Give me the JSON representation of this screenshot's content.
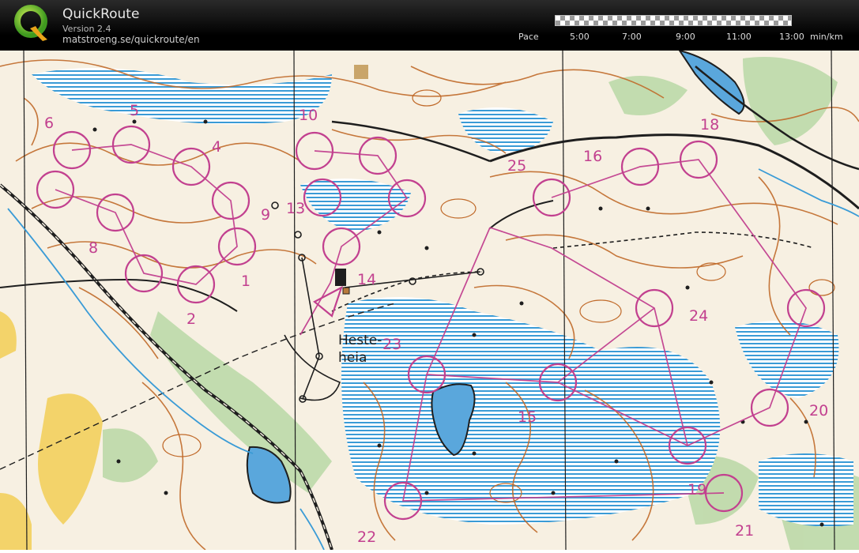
{
  "app": {
    "title": "QuickRoute",
    "version": "Version 2.4",
    "url": "matstroeng.se/quickroute/en",
    "logo_letter": "Q"
  },
  "pace_legend": {
    "label": "Pace",
    "ticks": [
      "5:00",
      "7:00",
      "9:00",
      "11:00",
      "13:00"
    ],
    "unit": "min/km"
  },
  "map": {
    "place_name_line1": "Heste-",
    "place_name_line2": "heia",
    "course_color": "#c2408f",
    "control_numbers": [
      {
        "id": "1",
        "label": "1"
      },
      {
        "id": "2",
        "label": "2"
      },
      {
        "id": "4",
        "label": "4"
      },
      {
        "id": "5",
        "label": "5"
      },
      {
        "id": "6",
        "label": "6"
      },
      {
        "id": "8",
        "label": "8"
      },
      {
        "id": "9",
        "label": "9"
      },
      {
        "id": "10",
        "label": "10"
      },
      {
        "id": "13",
        "label": "13"
      },
      {
        "id": "14",
        "label": "14"
      },
      {
        "id": "15",
        "label": "15"
      },
      {
        "id": "16",
        "label": "16"
      },
      {
        "id": "18",
        "label": "18"
      },
      {
        "id": "19",
        "label": "19"
      },
      {
        "id": "20",
        "label": "20"
      },
      {
        "id": "21",
        "label": "21"
      },
      {
        "id": "22",
        "label": "22"
      },
      {
        "id": "23",
        "label": "23"
      },
      {
        "id": "24",
        "label": "24"
      },
      {
        "id": "25",
        "label": "25"
      }
    ]
  }
}
